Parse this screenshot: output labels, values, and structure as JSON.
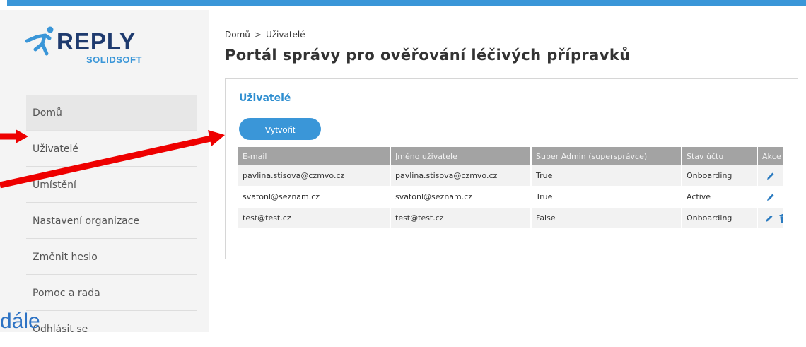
{
  "colors": {
    "accent": "#3a96d8",
    "title_blue": "#2e8ed0",
    "arrow_red": "#ee0000",
    "header_gray": "#a3a3a3"
  },
  "logo": {
    "brand": "REPLY",
    "sub": "SOLIDSOFT"
  },
  "sidebar": {
    "items": [
      {
        "label": "Domů",
        "active": true
      },
      {
        "label": "Uživatelé",
        "active": false
      },
      {
        "label": "Umístění",
        "active": false
      },
      {
        "label": "Nastavení organizace",
        "active": false
      },
      {
        "label": "Změnit heslo",
        "active": false
      },
      {
        "label": "Pomoc a rada",
        "active": false
      },
      {
        "label": "Odhlásit se",
        "active": false
      }
    ]
  },
  "breadcrumb": {
    "home": "Domů",
    "separator": ">",
    "current": "Uživatelé"
  },
  "page_title": "Portál správy pro ověřování léčivých přípravků",
  "card": {
    "title": "Uživatelé",
    "create_label": "Vytvořit",
    "columns": [
      "E-mail",
      "Jméno uživatele",
      "Super Admin (supersprávce)",
      "Stav účtu",
      "Akce"
    ],
    "rows": [
      {
        "email": "pavlina.stisova@czmvo.cz",
        "username": "pavlina.stisova@czmvo.cz",
        "super_admin": "True",
        "status": "Onboarding",
        "icons": [
          "edit-icon"
        ]
      },
      {
        "email": "svatonl@seznam.cz",
        "username": "svatonl@seznam.cz",
        "super_admin": "True",
        "status": "Active",
        "icons": [
          "edit-icon"
        ]
      },
      {
        "email": "test@test.cz",
        "username": "test@test.cz",
        "super_admin": "False",
        "status": "Onboarding",
        "icons": [
          "edit-icon",
          "trash-icon"
        ]
      }
    ]
  },
  "overlay": {
    "text": "dále"
  }
}
